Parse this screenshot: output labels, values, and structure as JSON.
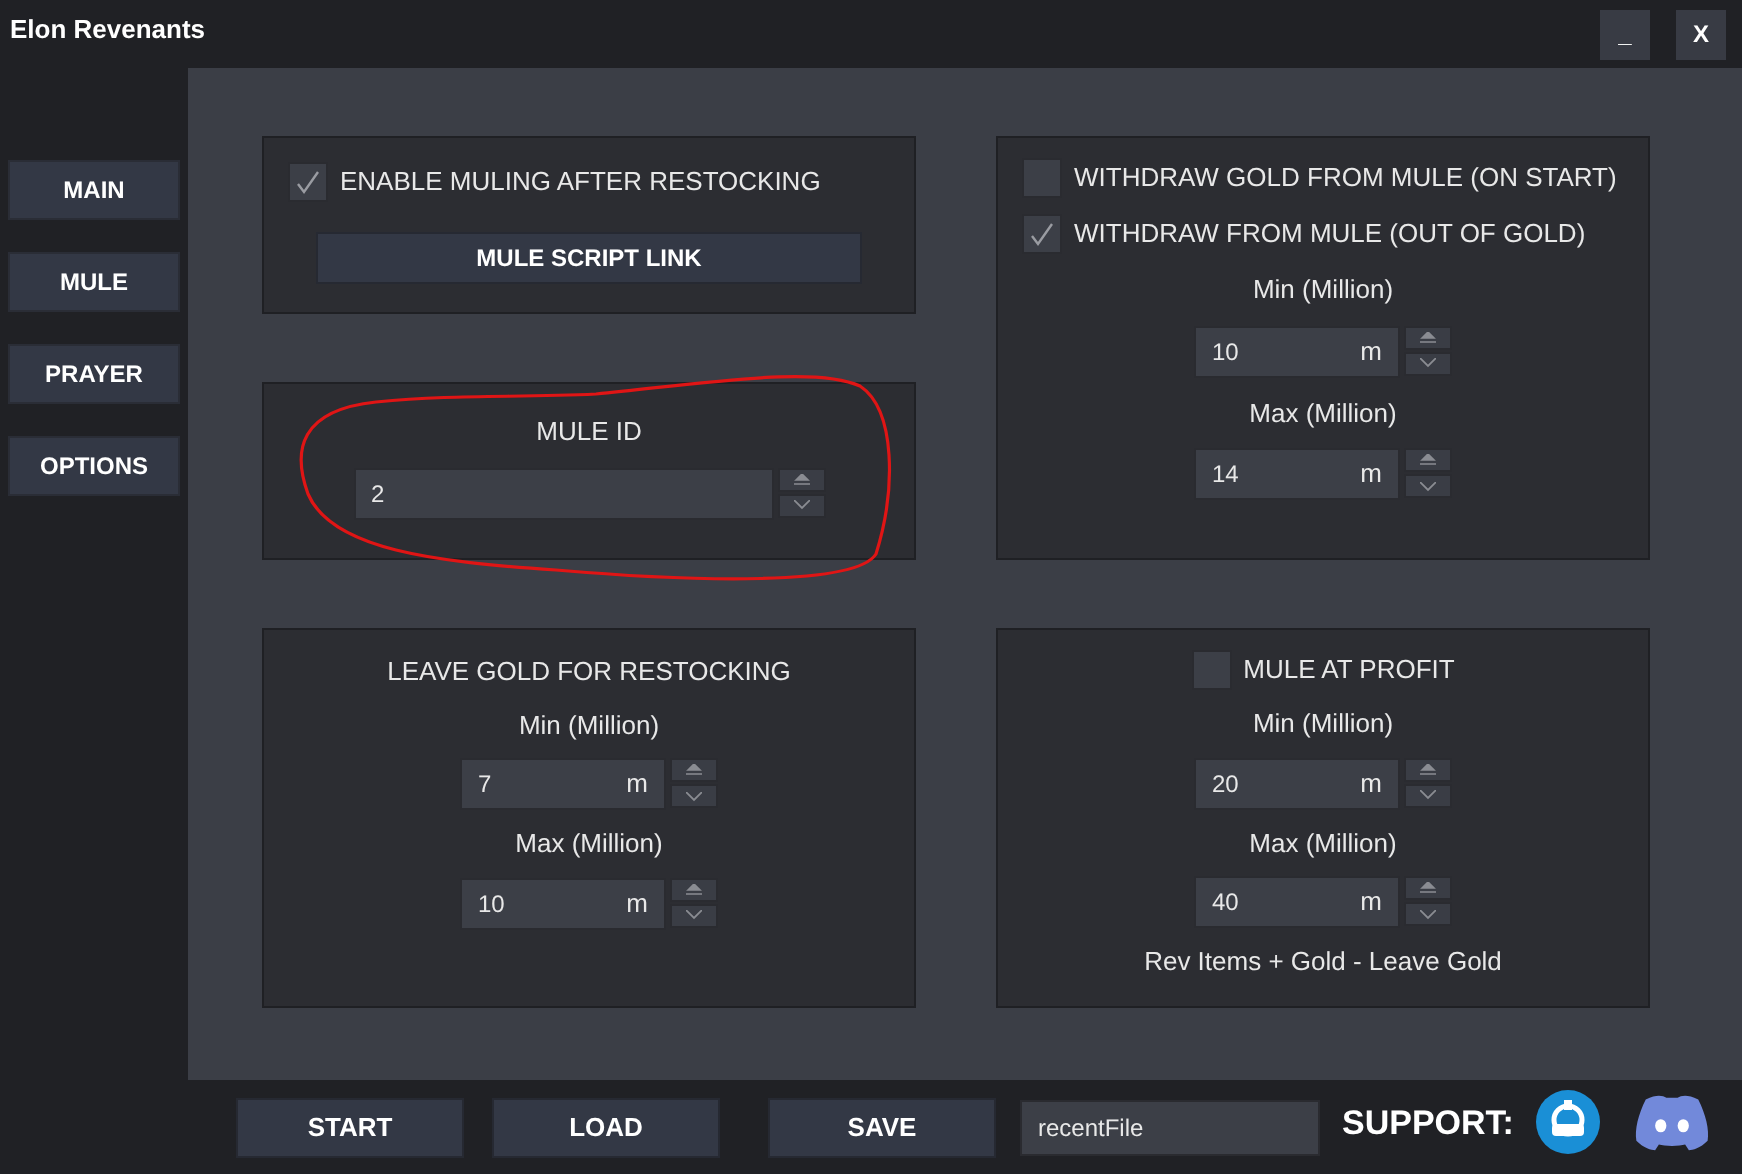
{
  "window": {
    "title": "Elon Revenants",
    "buttons": [
      "_",
      "X"
    ]
  },
  "sidebar": {
    "items": [
      {
        "label": "MAIN"
      },
      {
        "label": "MULE"
      },
      {
        "label": "PRAYER"
      },
      {
        "label": "OPTIONS"
      }
    ]
  },
  "columns": [
    {
      "panels": [
        {
          "highlighted": false,
          "items": [
            {
              "kind": "checkbox",
              "label": "ENABLE MULING AFTER RESTOCKING",
              "checked": true
            },
            {
              "kind": "button",
              "label": "MULE SCRIPT LINK"
            }
          ]
        },
        {
          "highlighted": true,
          "items": [
            {
              "kind": "heading",
              "text": "MULE ID"
            },
            {
              "kind": "id_field",
              "value": "2"
            }
          ]
        },
        {
          "highlighted": false,
          "items": [
            {
              "kind": "heading",
              "text": "LEAVE GOLD FOR RESTOCKING"
            },
            {
              "kind": "heading",
              "text": "Min (Million)"
            },
            {
              "kind": "spinner",
              "value": "7",
              "unit": "m"
            },
            {
              "kind": "heading",
              "text": "Max (Million)"
            },
            {
              "kind": "spinner",
              "value": "10",
              "unit": "m"
            }
          ]
        }
      ]
    },
    {
      "panels": [
        {
          "highlighted": false,
          "items": [
            {
              "kind": "checkbox",
              "label": "WITHDRAW GOLD FROM MULE (ON START)",
              "checked": false
            },
            {
              "kind": "checkbox",
              "label": "WITHDRAW FROM MULE (OUT OF GOLD)",
              "checked": true
            },
            {
              "kind": "heading",
              "text": "Min (Million)"
            },
            {
              "kind": "spinner",
              "value": "10",
              "unit": "m"
            },
            {
              "kind": "heading",
              "text": "Max (Million)"
            },
            {
              "kind": "spinner",
              "value": "14",
              "unit": "m"
            }
          ]
        },
        {
          "highlighted": false,
          "items": [
            {
              "kind": "checkbox",
              "label": "MULE AT PROFIT",
              "checked": false,
              "centered": true
            },
            {
              "kind": "heading",
              "text": "Min (Million)"
            },
            {
              "kind": "spinner",
              "value": "20",
              "unit": "m"
            },
            {
              "kind": "heading",
              "text": "Max (Million)"
            },
            {
              "kind": "spinner",
              "value": "40",
              "unit": "m"
            },
            {
              "kind": "heading",
              "text": "Rev Items + Gold - Leave Gold"
            }
          ]
        }
      ]
    }
  ],
  "footer": {
    "buttons": [
      "START",
      "LOAD",
      "SAVE"
    ],
    "file_field": {
      "value": "recentFile"
    },
    "support_label": "SUPPORT:"
  }
}
